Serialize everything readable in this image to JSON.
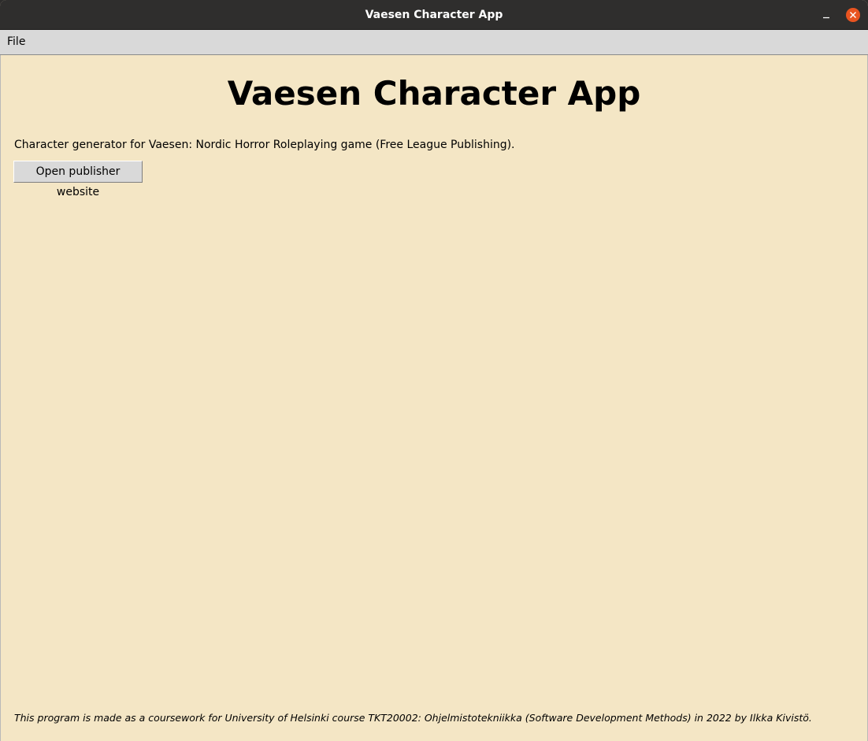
{
  "window": {
    "title": "Vaesen Character App",
    "controls": {
      "minimize_icon": "minimize-icon",
      "close_icon": "close-icon",
      "close_color": "#e95420"
    }
  },
  "menubar": {
    "items": [
      {
        "label": "File"
      }
    ]
  },
  "main": {
    "heading": "Vaesen Character App",
    "description": "Character generator for Vaesen: Nordic Horror Roleplaying game (Free League Publishing).",
    "publisher_button_label": "Open publisher website",
    "footer": "This program is made as a coursework for University of Helsinki course TKT20002: Ohjelmistotekniikka (Software Development Methods) in 2022 by Ilkka Kivistö."
  },
  "colors": {
    "background": "#f4e6c5",
    "titlebar": "#2f2e2d",
    "menubar": "#d9d9d9",
    "button": "#d9d9d9"
  }
}
